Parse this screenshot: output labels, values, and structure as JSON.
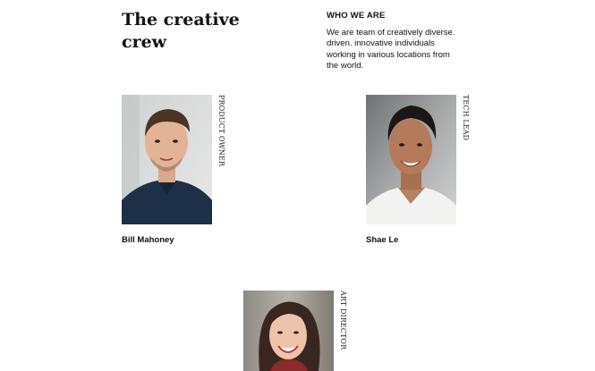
{
  "header": {
    "title_line1": "The creative",
    "title_line2": "crew"
  },
  "about": {
    "heading": "WHO WE ARE",
    "line1": "We are team of creatively diverse.",
    "line2": "driven. innovative individuals",
    "line3": "working in various locations from",
    "line4": "the world."
  },
  "team": [
    {
      "name": "Bill Mahoney",
      "role": "PRODUCT OWNER",
      "photo_icon": "portrait-photo"
    },
    {
      "name": "Shae Le",
      "role": "TECH LEAD",
      "photo_icon": "portrait-photo"
    },
    {
      "name": "",
      "role": "ART DIRECTOR",
      "photo_icon": "portrait-photo"
    }
  ]
}
